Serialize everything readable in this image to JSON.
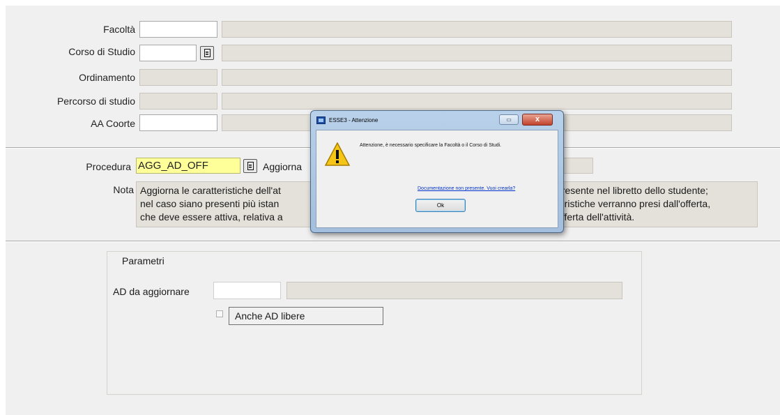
{
  "form": {
    "facolta_label": "Facoltà",
    "corso_label": "Corso di Studio",
    "ordinamento_label": "Ordinamento",
    "percorso_label": "Percorso di studio",
    "aa_coorte_label": "AA Coorte"
  },
  "procedure": {
    "label": "Procedura",
    "code": "AGG_AD_OFF",
    "name_partial": "Aggiorna",
    "nota_label": "Nota",
    "nota_lines": [
      "Aggiorna le caratteristiche dell'at",
      "nel caso siano presenti più istan",
      "che deve essere attiva, relativa a"
    ],
    "nota_right_lines": [
      "presente nel libretto dello studente;",
      "teristiche verranno presi dall'offerta,",
      "offerta dell'attività."
    ]
  },
  "parametri": {
    "title": "Parametri",
    "ad_label": "AD da aggiornare",
    "anche_label": "Anche AD libere"
  },
  "dialog": {
    "title": "ESSE3 - Attenzione",
    "message": "Attenzione, è necessario specificare la Facoltà o il Corso di Studi.",
    "link": "Documentazione non presente. Vuoi crearla?",
    "ok": "Ok",
    "close": "x",
    "icon": "warning-icon"
  },
  "colors": {
    "background": "#f0f0f0",
    "readonly_field": "#e4e0da",
    "procedure_field": "#ffff99",
    "dialog_frame": "#b9d1ea",
    "close_button": "#c2422c"
  }
}
